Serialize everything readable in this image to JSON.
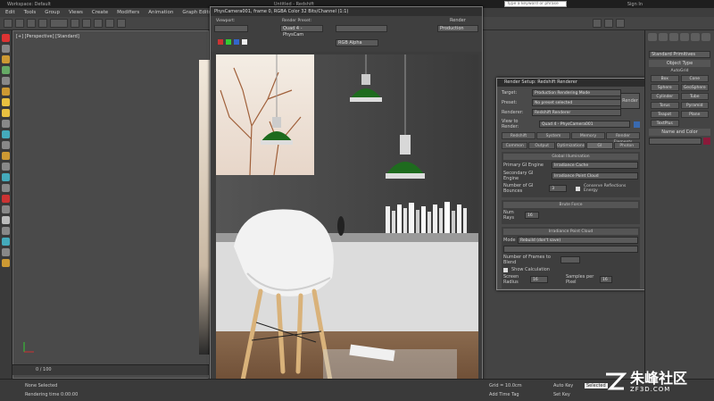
{
  "titlebar": {
    "workspace": "Workspace: Default",
    "file": "Untitled - Redshift",
    "sign_in": "Sign In"
  },
  "search": {
    "placeholder": "Type a keyword or phrase"
  },
  "menubar": {
    "items": [
      "Edit",
      "Tools",
      "Group",
      "Views",
      "Create",
      "Modifiers",
      "Animation",
      "Graph Editors"
    ]
  },
  "viewport": {
    "label": "[+] [Perspective] [Standard]"
  },
  "frame_buffer": {
    "title": "PhysCamera001, frame 0, RGBA Color 32 Bits/Channel (1:1)",
    "viewport_label": "Viewport:",
    "viewport_value": "Quad 4 - PhysCam",
    "render_preset_label": "Render Preset:",
    "render_label": "Render",
    "production_value": "Production",
    "area_value": "RGB Alpha"
  },
  "render_setup": {
    "title": "Render Setup: Redshift Renderer",
    "target_label": "Target:",
    "target_value": "Production Rendering Mode",
    "preset_label": "Preset:",
    "preset_value": "No preset selected",
    "renderer_label": "Renderer:",
    "renderer_value": "Redshift Renderer",
    "view_label": "View to Render:",
    "view_value": "Quad 4 - PhysCamera001",
    "render_button": "Render",
    "tabs_row1": [
      "Redshift",
      "System",
      "Memory",
      "Render Elements"
    ],
    "tabs_row2": [
      "Common",
      "Output",
      "Optimizations",
      "GI",
      "Photon"
    ],
    "gi_section": "Global Illumination",
    "primary_label": "Primary GI Engine",
    "primary_value": "Irradiance Cache",
    "secondary_label": "Secondary GI Engine",
    "secondary_value": "Irradiance Point Cloud",
    "bounces_label": "Number of GI Bounces",
    "bounces_value": "3",
    "conserve_label": "Conserve Reflections Energy",
    "brute_section": "Brute Force",
    "num_rays_label": "Num Rays",
    "num_rays_value": "16",
    "irr_section": "Irradiance Point Cloud",
    "mode_label": "Mode",
    "mode_value": "Rebuild (don't save)",
    "frames_label": "Number of Frames to Blend",
    "show_calc_label": "Show Calculation",
    "screen_radius_label": "Screen Radius",
    "screen_radius_value": "16",
    "samples_label": "Samples per Pixel",
    "samples_value": "16"
  },
  "command_panel": {
    "category": "Standard Primitives",
    "object_type": "Object Type",
    "autogrid": "AutoGrid",
    "buttons": [
      "Box",
      "Cone",
      "Sphere",
      "GeoSphere",
      "Cylinder",
      "Tube",
      "Torus",
      "Pyramid",
      "Teapot",
      "Plane",
      "TextPlus"
    ],
    "name_color": "Name and Color"
  },
  "timeline": {
    "frame": "0 / 100"
  },
  "status": {
    "selection": "None Selected",
    "prompt": "Rendering time 0:00:00",
    "grid": "Grid = 10.0cm",
    "add_time_tag": "Add Time Tag",
    "autokey": "Auto Key",
    "selected": "Selected",
    "set_key": "Set Key",
    "key_filters": "Key Filters..."
  },
  "watermark": {
    "cn": "朱峰社区",
    "url": "ZF3D.COM"
  },
  "colors": {
    "lamp_green": "#1e6b1e",
    "panel": "#444444",
    "accent": "#3a6ab0"
  }
}
